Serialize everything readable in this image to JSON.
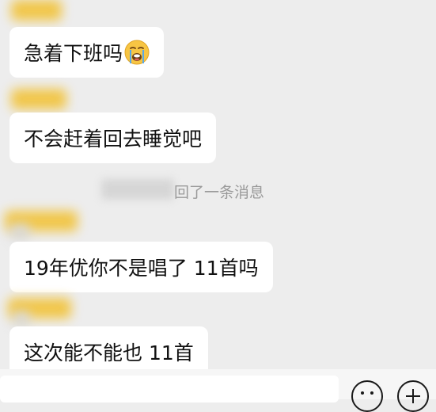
{
  "messages": [
    {
      "text": "急着下班吗",
      "emoji": "loudly-crying-face"
    },
    {
      "text": "不会赶着回去睡觉吧"
    },
    {
      "text": "19年优你不是唱了 11首吗"
    },
    {
      "text": "这次能不能也 11首"
    }
  ],
  "system_notice": {
    "text": "回了一条消息"
  },
  "colors": {
    "background": "#ededed",
    "bubble": "#ffffff",
    "blur_yellow": "#f2c02e",
    "notice_text": "#9a9a9a"
  },
  "icons": {
    "emoji_button": "smiley-face-icon",
    "more_button": "plus-circle-icon"
  }
}
